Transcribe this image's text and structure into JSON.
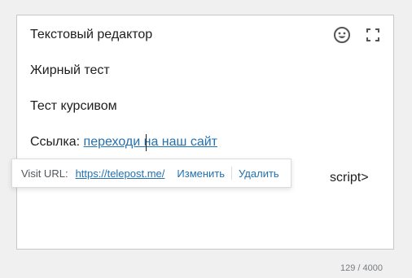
{
  "editor": {
    "title": "Текстовый редактор",
    "icons": [
      "emoji-icon",
      "fullscreen-icon"
    ],
    "lines": {
      "bold": "Жирный тест",
      "italic": "Тест курсивом",
      "link_prefix": "Ссылка: ",
      "link_text": "переходи на наш сайт",
      "hidden_tail": "script>"
    }
  },
  "link_popover": {
    "label": "Visit URL:",
    "url": "https://telepost.me/",
    "edit_label": "Изменить",
    "remove_label": "Удалить"
  },
  "counter": "129 / 4000",
  "colors": {
    "link": "#2271b1",
    "text": "#1e1e1e",
    "border": "#c7c7c7",
    "background": "#f0f0f0"
  }
}
